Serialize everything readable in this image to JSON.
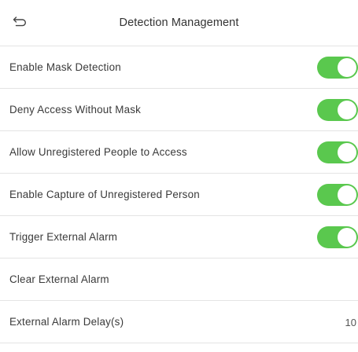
{
  "header": {
    "title": "Detection Management",
    "back_icon": "back-arrow-icon"
  },
  "settings": [
    {
      "label": "Enable Mask Detection",
      "toggle": true
    },
    {
      "label": "Deny Access Without Mask",
      "toggle": true
    },
    {
      "label": "Allow Unregistered People to Access",
      "toggle": true
    },
    {
      "label": "Enable Capture of Unregistered Person",
      "toggle": true
    },
    {
      "label": "Trigger External Alarm",
      "toggle": true
    },
    {
      "label": "Clear External Alarm"
    },
    {
      "label": "External Alarm Delay(s)",
      "value": "10"
    }
  ],
  "colors": {
    "toggle_on": "#5ac84e",
    "divider": "#e4e4e4"
  }
}
